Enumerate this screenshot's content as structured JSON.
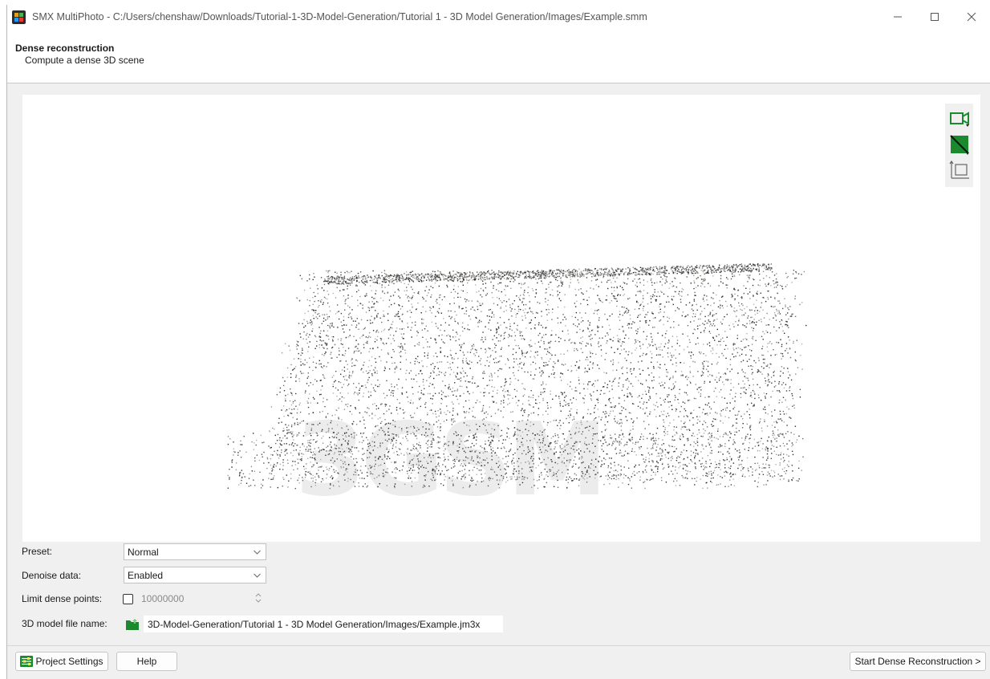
{
  "window": {
    "title": "SMX MultiPhoto - C:/Users/chenshaw/Downloads/Tutorial-1-3D-Model-Generation/Tutorial 1 - 3D Model Generation/Images/Example.smm"
  },
  "header": {
    "title": "Dense reconstruction",
    "subtitle": "Compute a dense 3D scene"
  },
  "viewport": {
    "watermark": "3GSM",
    "tools": [
      "camera-view-icon",
      "toggle-fill-icon",
      "axes-frame-icon"
    ]
  },
  "form": {
    "preset_label": "Preset:",
    "preset_value": "Normal",
    "denoise_label": "Denoise data:",
    "denoise_value": "Enabled",
    "limit_label": "Limit dense points:",
    "limit_checked": false,
    "limit_value": "10000000",
    "model_label": "3D model file name:",
    "model_path": "3D-Model-Generation/Tutorial 1 - 3D Model Generation/Images/Example.jm3x"
  },
  "footer": {
    "project_settings": "Project Settings",
    "help": "Help",
    "start": "Start Dense Reconstruction >"
  },
  "colors": {
    "accent_green": "#1b8a2e",
    "background": "#f0f0f0"
  }
}
